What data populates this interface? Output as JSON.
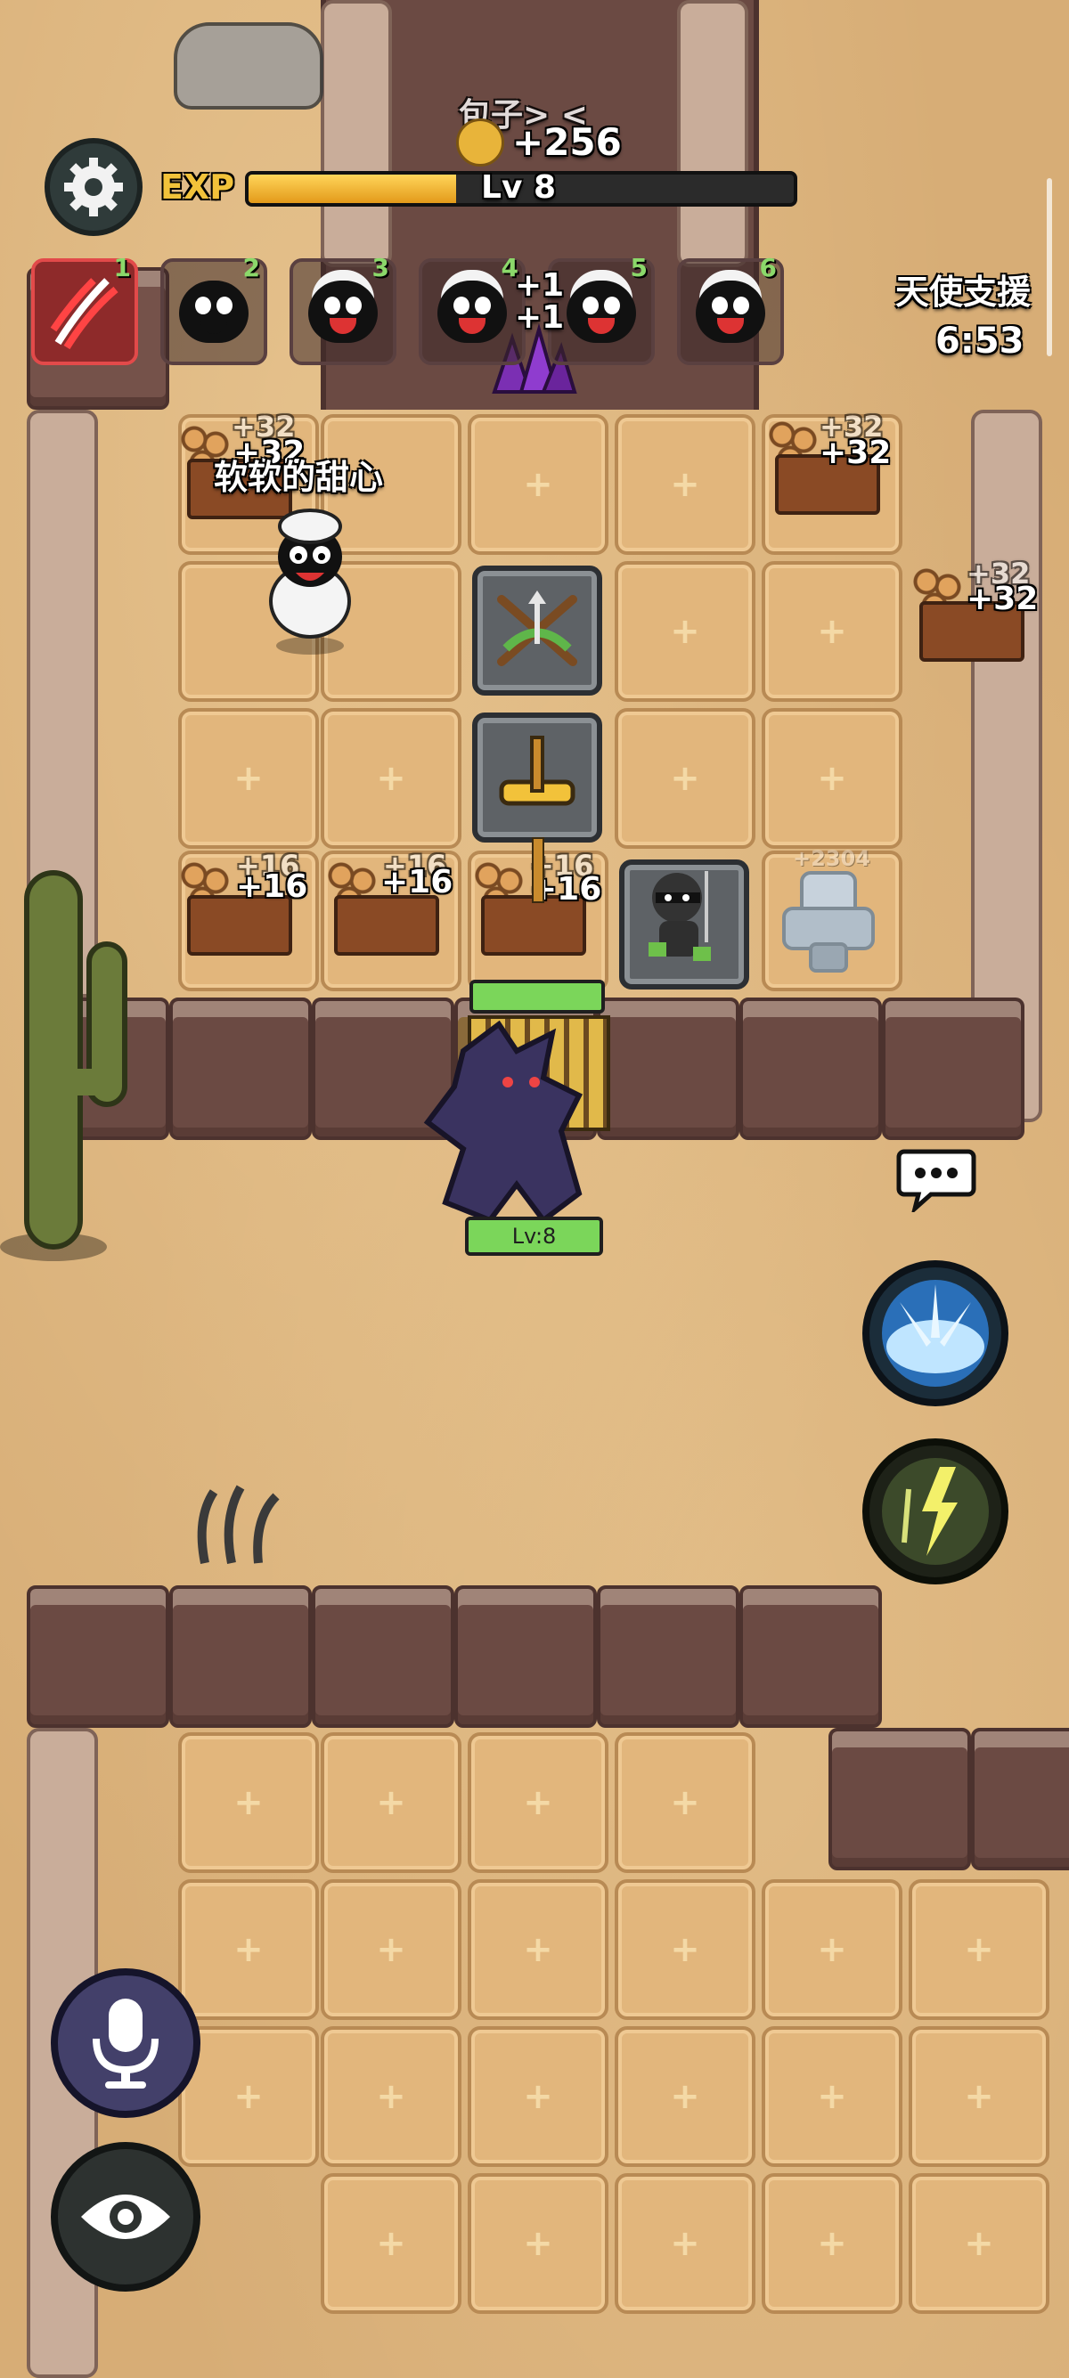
{
  "hud": {
    "exp_label": "EXP",
    "level_label": "Lv 8",
    "exp_progress": 0.38,
    "support_title": "天使支援",
    "support_timer": "6:53",
    "top_label": "包子> <",
    "top_gain": "+256"
  },
  "team_slots": [
    {
      "number": "1",
      "name": "claw-skill-icon",
      "active": true
    },
    {
      "number": "2",
      "name": "black-sheep-icon"
    },
    {
      "number": "3",
      "name": "sheep-icon"
    },
    {
      "number": "4",
      "name": "sheep-icon"
    },
    {
      "number": "5",
      "name": "sheep-icon"
    },
    {
      "number": "6",
      "name": "sheep-icon"
    }
  ],
  "slot_overlay": {
    "line1": "+1",
    "line2": "+1"
  },
  "player": {
    "name": "软软的甜心"
  },
  "lumber_yields": {
    "a": {
      "back": "+32",
      "front": "+32"
    },
    "b": {
      "back": "+32",
      "front": "+32"
    },
    "c": {
      "back": "+32",
      "front": "+32"
    },
    "d": {
      "back": "+16",
      "front": "+16"
    },
    "e": {
      "back": "+16",
      "front": "+16"
    },
    "f": {
      "back": "+16",
      "front": "+16"
    }
  },
  "turret_gain": "+2304",
  "boss": {
    "level": "Lv:8"
  },
  "icons": {
    "settings": "gear-icon",
    "chat": "chat-bubble-icon",
    "skill1": "ice-burst-icon",
    "skill2": "lightning-figure-icon",
    "mic": "microphone-icon",
    "eye": "eye-icon"
  },
  "colors": {
    "exp_fill": "#f2b328",
    "level_bar_green": "#7bd65a",
    "sand": "#d7ad76"
  }
}
